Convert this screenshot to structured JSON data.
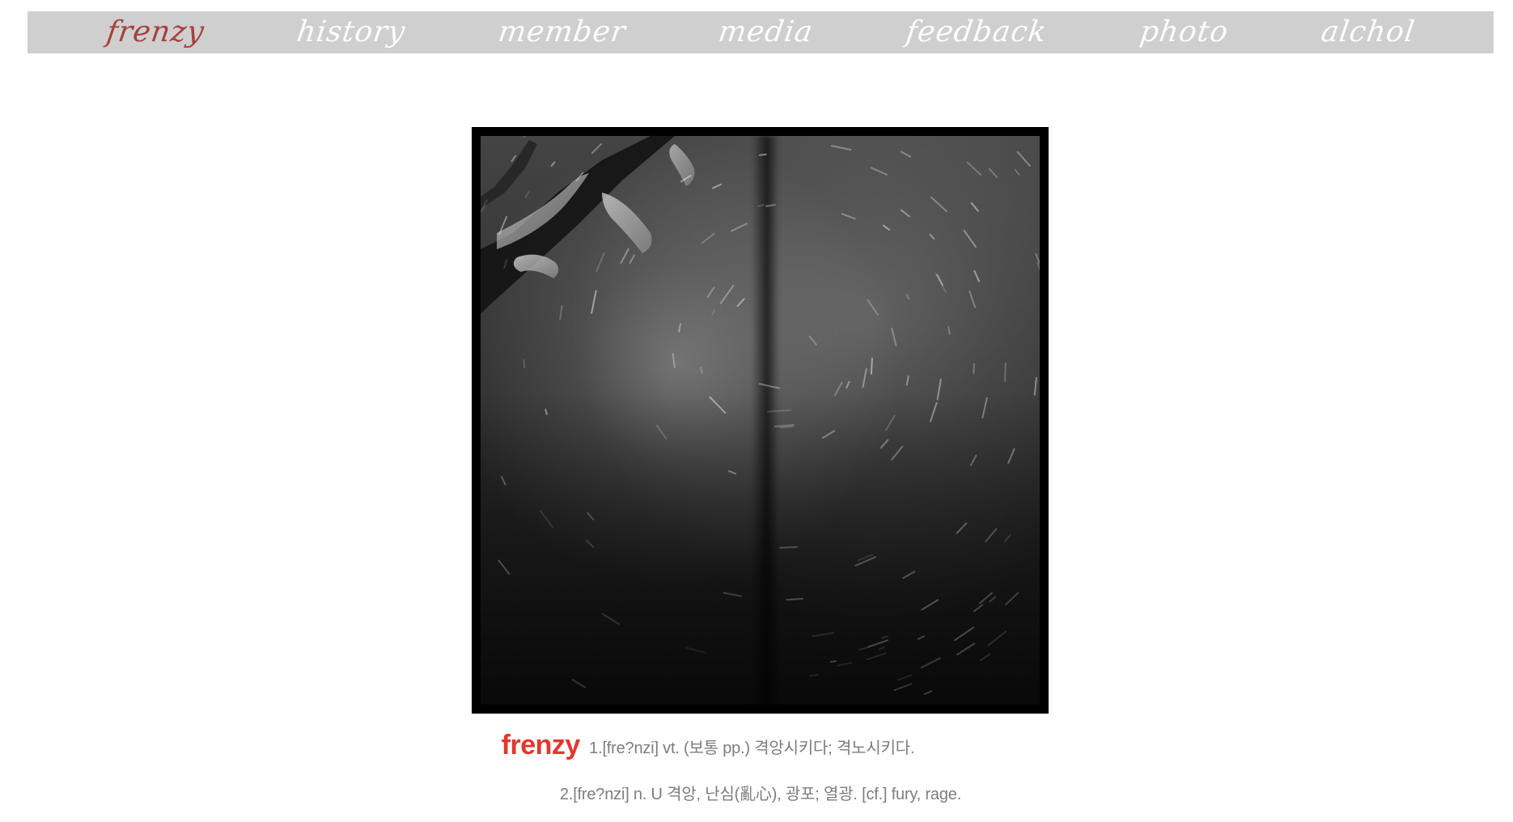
{
  "nav": {
    "items": [
      {
        "label": "frenzy",
        "active": true
      },
      {
        "label": "history",
        "active": false
      },
      {
        "label": "member",
        "active": false
      },
      {
        "label": "media",
        "active": false
      },
      {
        "label": "feedback",
        "active": false
      },
      {
        "label": "photo",
        "active": false
      },
      {
        "label": "alchol",
        "active": false
      }
    ],
    "colors": {
      "bar": "#cfcfcf",
      "inactive": "#ffffff",
      "active": "#a33a35"
    }
  },
  "photo": {
    "description_icon": "photo-image"
  },
  "definition": {
    "word": "frenzy",
    "line1": "1.[fre?nzi] vt. (보통 pp.) 격앙시키다; 격노시키다.",
    "line2": "2.[fre?nzi] n. U 격앙, 난심(亂心), 광포; 열광. [cf.] fury, rage.",
    "colors": {
      "word": "#e2372f",
      "text": "#7d7d7d"
    }
  }
}
